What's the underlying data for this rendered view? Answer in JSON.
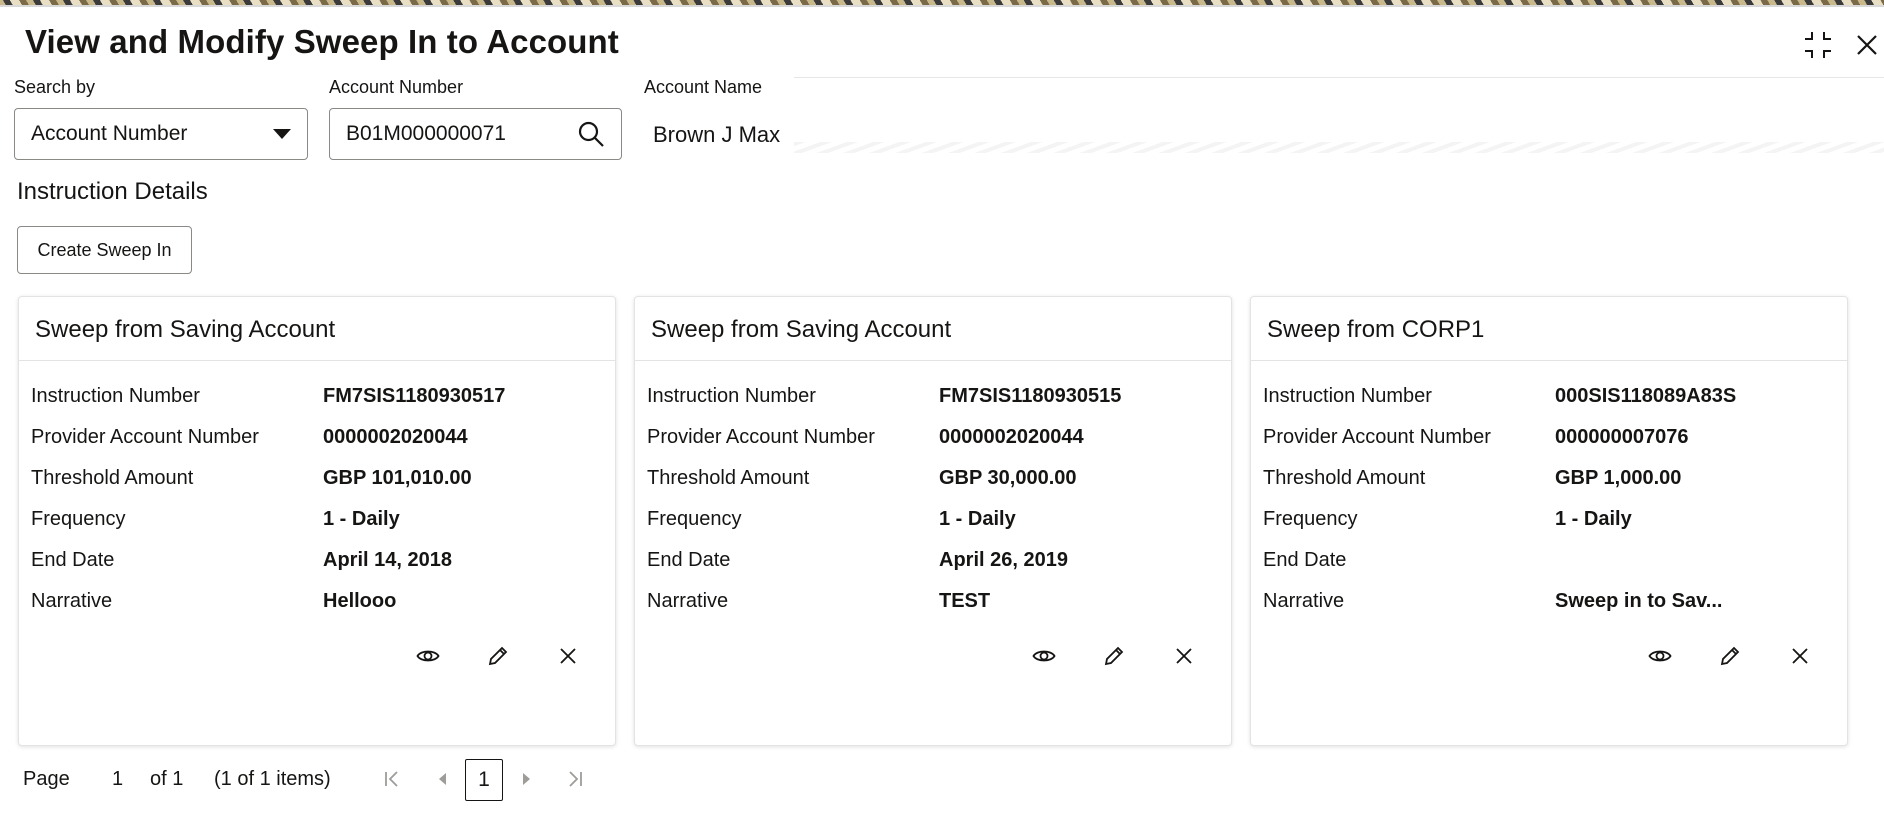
{
  "window": {
    "title": "View and Modify Sweep In to Account"
  },
  "search": {
    "search_by_label": "Search by",
    "search_by_value": "Account Number",
    "account_number_label": "Account Number",
    "account_number_value": "B01M000000071",
    "account_name_label": "Account Name",
    "account_name_value": "Brown J Max"
  },
  "section": {
    "title": "Instruction Details",
    "create_button": "Create Sweep In"
  },
  "labels": {
    "instruction_number": "Instruction Number",
    "provider_account_number": "Provider Account Number",
    "threshold_amount": "Threshold Amount",
    "frequency": "Frequency",
    "end_date": "End Date",
    "narrative": "Narrative"
  },
  "cards": [
    {
      "title": "Sweep from Saving Account",
      "instruction_number": "FM7SIS1180930517",
      "provider_account_number": "0000002020044",
      "threshold_amount": "GBP 101,010.00",
      "frequency": "1 - Daily",
      "end_date": "April 14, 2018",
      "narrative": "Hellooo"
    },
    {
      "title": "Sweep from Saving Account",
      "instruction_number": "FM7SIS1180930515",
      "provider_account_number": "0000002020044",
      "threshold_amount": "GBP 30,000.00",
      "frequency": "1 - Daily",
      "end_date": "April 26, 2019",
      "narrative": "TEST"
    },
    {
      "title": "Sweep from CORP1",
      "instruction_number": "000SIS118089A83S",
      "provider_account_number": "000000007076",
      "threshold_amount": "GBP 1,000.00",
      "frequency": "1 - Daily",
      "end_date": "",
      "narrative": "Sweep in to Sav..."
    }
  ],
  "pagination": {
    "page_label": "Page",
    "page_input": "1",
    "of_label": "of 1",
    "items_label": "(1 of 1 items)",
    "current_page": "1"
  },
  "icons": {
    "minimize": "minimize-icon",
    "close": "close-icon",
    "dropdown": "chevron-down-icon",
    "search": "search-icon",
    "view": "eye-icon",
    "edit": "pencil-icon",
    "delete": "close-icon",
    "first": "first-page-icon",
    "prev": "previous-page-icon",
    "next": "next-page-icon",
    "last": "last-page-icon"
  },
  "colors": {
    "text": "#161513",
    "border": "#8b8985",
    "disabled_icon": "#b0aeab"
  }
}
